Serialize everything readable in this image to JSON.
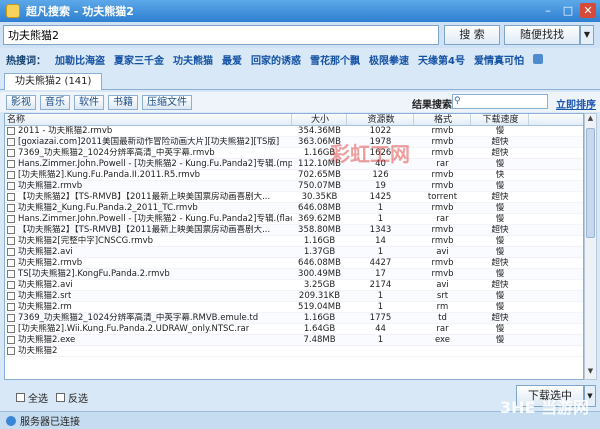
{
  "window": {
    "title": "超凡搜索 - 功夫熊猫2"
  },
  "search": {
    "value": "功夫熊猫2",
    "button": "搜 索",
    "random_button": "随便找找"
  },
  "hot": {
    "label": "热搜词：",
    "items": [
      "加勒比海盗",
      "夏家三千金",
      "功夫熊猫",
      "最爱",
      "回家的诱惑",
      "雪花那个飘",
      "极限拳速",
      "天缘第4号",
      "爱情真可怕"
    ]
  },
  "tab": {
    "label": "功夫熊猫2 (141)"
  },
  "filters": [
    "影视",
    "音乐",
    "软件",
    "书籍",
    "压缩文件"
  ],
  "result_search": {
    "label": "结果搜索：",
    "sort_link": "立即排序"
  },
  "columns": {
    "name": "名称",
    "size": "大小",
    "count": "资源数",
    "format": "格式",
    "speed": "下载速度"
  },
  "rows": [
    {
      "name": "2011 - 功夫熊猫2.rmvb",
      "size": "354.36MB",
      "count": "1022",
      "format": "rmvb",
      "speed": "慢"
    },
    {
      "name": "[goxiazai.com]2011美国最新动作冒险动画大片][功夫熊猫2][TS版]",
      "size": "363.06MB",
      "count": "1978",
      "format": "rmvb",
      "speed": "超快"
    },
    {
      "name": "7369_功夫熊猫2_1024分辨率高清_中英字幕.rmvb",
      "size": "1.16GB",
      "count": "1626",
      "format": "rmvb",
      "speed": "超快"
    },
    {
      "name": "Hans.Zimmer.John.Powell - [功夫熊猫2 - Kung.Fu.Panda2]专辑.(mp3).rar",
      "size": "112.10MB",
      "count": "40",
      "format": "rar",
      "speed": "慢"
    },
    {
      "name": "[功夫熊猫2].Kung.Fu.Panda.II.2011.R5.rmvb",
      "size": "702.65MB",
      "count": "126",
      "format": "rmvb",
      "speed": "快"
    },
    {
      "name": "功夫熊猫2.rmvb",
      "size": "750.07MB",
      "count": "19",
      "format": "rmvb",
      "speed": "慢"
    },
    {
      "name": "【功夫熊猫2】【TS-RMVB】【2011最新上映美国票房动画喜剧大...",
      "size": "30.35KB",
      "count": "1425",
      "format": "torrent",
      "speed": "超快"
    },
    {
      "name": "功夫熊猫2_Kung.Fu.Panda.2_2011_TC.rmvb",
      "size": "646.08MB",
      "count": "1",
      "format": "rmvb",
      "speed": "慢"
    },
    {
      "name": "Hans.Zimmer.John.Powell - [功夫熊猫2 - Kung.Fu.Panda2]专辑.(flac).rar",
      "size": "369.62MB",
      "count": "1",
      "format": "rar",
      "speed": "慢"
    },
    {
      "name": "【功夫熊猫2】【TS-RMVB】【2011最新上映美国票房动画喜剧大...",
      "size": "358.80MB",
      "count": "1343",
      "format": "rmvb",
      "speed": "超快"
    },
    {
      "name": "功夫熊猫2[完整中字]CNSCG.rmvb",
      "size": "1.16GB",
      "count": "14",
      "format": "rmvb",
      "speed": "慢"
    },
    {
      "name": "功夫熊猫2.avi",
      "size": "1.37GB",
      "count": "1",
      "format": "avi",
      "speed": "慢"
    },
    {
      "name": "功夫熊猫2.rmvb",
      "size": "646.08MB",
      "count": "4427",
      "format": "rmvb",
      "speed": "超快"
    },
    {
      "name": "TS[功夫熊猫2].KongFu.Panda.2.rmvb",
      "size": "300.49MB",
      "count": "17",
      "format": "rmvb",
      "speed": "慢"
    },
    {
      "name": "功夫熊猫2.avi",
      "size": "3.25GB",
      "count": "2174",
      "format": "avi",
      "speed": "超快"
    },
    {
      "name": "功夫熊猫2.srt",
      "size": "209.31KB",
      "count": "1",
      "format": "srt",
      "speed": "慢"
    },
    {
      "name": "功夫熊猫2.rm",
      "size": "519.04MB",
      "count": "1",
      "format": "rm",
      "speed": "慢"
    },
    {
      "name": "7369_功夫熊猫2_1024分辨率高清_中英字幕.RMVB.emule.td",
      "size": "1.16GB",
      "count": "1775",
      "format": "td",
      "speed": "超快"
    },
    {
      "name": "[功夫熊猫2].Wii.Kung.Fu.Panda.2.UDRAW_only.NTSC.rar",
      "size": "1.64GB",
      "count": "44",
      "format": "rar",
      "speed": "慢"
    },
    {
      "name": "功夫熊猫2.exe",
      "size": "7.48MB",
      "count": "1",
      "format": "exe",
      "speed": "慢"
    },
    {
      "name": "功夫熊猫2",
      "size": "",
      "count": "",
      "format": "",
      "speed": ""
    }
  ],
  "bottom": {
    "select_all": "全选",
    "invert": "反选",
    "download_button": "下载选中"
  },
  "status": {
    "text": "服务器已连接"
  },
  "watermarks": {
    "top": "彩虹工网",
    "bottom": "3HE 当游网"
  }
}
